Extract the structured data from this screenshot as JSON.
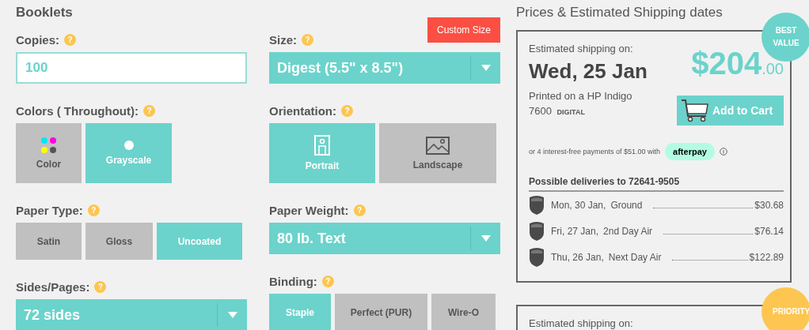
{
  "title": "Booklets",
  "custom_size_button": "Custom Size",
  "columns": [
    [
      {
        "kind": "input",
        "label": "Copies:",
        "help": "?",
        "value": "100"
      },
      {
        "kind": "icon-options",
        "label": "Colors ( Throughout):",
        "help": "?",
        "options": [
          {
            "label": "Color",
            "kind": "ink-dots",
            "selected": false
          },
          {
            "label": "Grayscale",
            "kind": "dot",
            "selected": true
          }
        ]
      },
      {
        "kind": "options",
        "label": "Paper Type:",
        "help": "?",
        "options": [
          {
            "label": "Satin",
            "selected": false
          },
          {
            "label": "Gloss",
            "selected": false
          },
          {
            "label": "Uncoated",
            "selected": true
          }
        ]
      },
      {
        "kind": "select",
        "label": "Sides/Pages:",
        "help": "?",
        "value": "72 sides"
      }
    ],
    [
      {
        "kind": "select",
        "label": "Size:",
        "help": "?",
        "value": "Digest (5.5\" x 8.5\")"
      },
      {
        "kind": "icon-options",
        "label": "Orientation:",
        "help": "?",
        "options": [
          {
            "label": "Portrait",
            "kind": "portrait",
            "selected": true
          },
          {
            "label": "Landscape",
            "kind": "landscape",
            "selected": false
          }
        ]
      },
      {
        "kind": "select",
        "label": "Paper Weight:",
        "help": "?",
        "value": "80 lb. Text"
      },
      {
        "kind": "options",
        "label": "Binding:",
        "help": "?",
        "options": [
          {
            "label": "Staple",
            "selected": true
          },
          {
            "label": "Perfect (PUR)",
            "selected": false
          },
          {
            "label": "Wire-O",
            "selected": false
          }
        ]
      }
    ]
  ],
  "prices": {
    "heading": "Prices & Estimated Shipping dates",
    "cards": [
      {
        "badge": "BEST VALUE",
        "color": "#6bd3cb",
        "estimated_label": "Estimated shipping on:",
        "date": "Wed, 25 Jan",
        "printer": "Printed on a HP Indigo 7600",
        "printer_tag": "DIGITAL",
        "price": "$204",
        "cents": ".00",
        "cart_button": "Add to Cart",
        "installments": "or 4 interest-free payments of $51.00 with",
        "afterpay": "afterpay",
        "deliveries_heading": "Possible deliveries to 72641-9505",
        "deliveries": [
          {
            "date": "Mon, 30 Jan,",
            "service": "Ground",
            "price": "$30.68"
          },
          {
            "date": "Fri, 27 Jan,",
            "service": "2nd Day Air",
            "price": "$76.14"
          },
          {
            "date": "Thu, 26 Jan,",
            "service": "Next Day Air",
            "price": "$122.89"
          }
        ]
      },
      {
        "badge": "PRIORITY",
        "color": "#fcc650",
        "estimated_label": "Estimated shipping on:"
      }
    ]
  }
}
